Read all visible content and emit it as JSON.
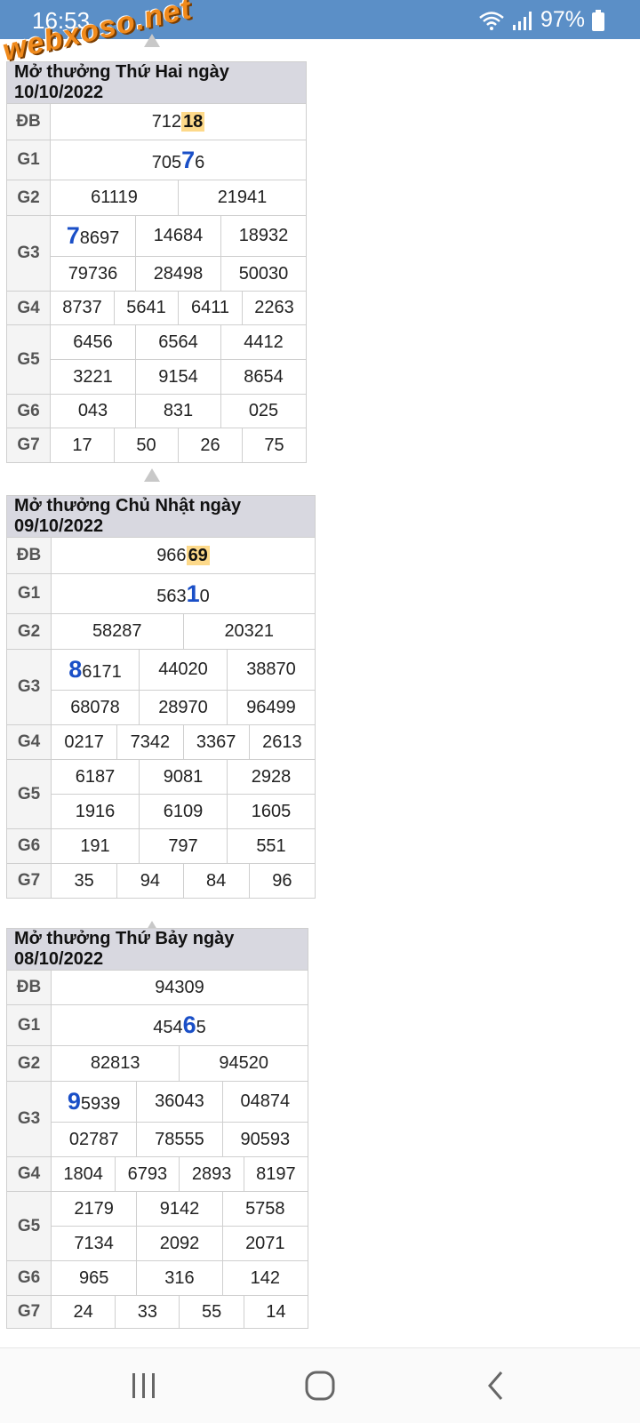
{
  "status_bar": {
    "time": "16:53",
    "battery": "97%"
  },
  "watermark": "webxoso.net",
  "draws": [
    {
      "title": "Mở thưởng Thứ Hai ngày 10/10/2022",
      "db": {
        "prefix": "712",
        "tail": "18"
      },
      "g1": {
        "before": "705",
        "big": "7",
        "after": "6"
      },
      "g2": [
        "61119",
        "21941"
      ],
      "g3": {
        "first_big": "7",
        "first_rest": "8697",
        "others": [
          "14684",
          "18932",
          "79736",
          "28498",
          "50030"
        ]
      },
      "g4": [
        "8737",
        "5641",
        "6411",
        "2263"
      ],
      "g5": [
        "6456",
        "6564",
        "4412",
        "3221",
        "9154",
        "8654"
      ],
      "g6": [
        "043",
        "831",
        "025"
      ],
      "g7": [
        "17",
        "50",
        "26",
        "75"
      ]
    },
    {
      "title": "Mở thưởng Chủ Nhật ngày 09/10/2022",
      "db": {
        "prefix": "966",
        "tail": "69"
      },
      "g1": {
        "before": "563",
        "big": "1",
        "after": "0"
      },
      "g2": [
        "58287",
        "20321"
      ],
      "g3": {
        "first_big": "8",
        "first_rest": "6171",
        "others": [
          "44020",
          "38870",
          "68078",
          "28970",
          "96499"
        ]
      },
      "g4": [
        "0217",
        "7342",
        "3367",
        "2613"
      ],
      "g5": [
        "6187",
        "9081",
        "2928",
        "1916",
        "6109",
        "1605"
      ],
      "g6": [
        "191",
        "797",
        "551"
      ],
      "g7": [
        "35",
        "94",
        "84",
        "96"
      ]
    },
    {
      "title": "Mở thưởng Thứ Bảy ngày 08/10/2022",
      "db": {
        "prefix": "94309",
        "tail": ""
      },
      "g1": {
        "before": "454",
        "big": "6",
        "after": "5"
      },
      "g2": [
        "82813",
        "94520"
      ],
      "g3": {
        "first_big": "9",
        "first_rest": "5939",
        "others": [
          "36043",
          "04874",
          "02787",
          "78555",
          "90593"
        ]
      },
      "g4": [
        "1804",
        "6793",
        "2893",
        "8197"
      ],
      "g5": [
        "2179",
        "9142",
        "5758",
        "7134",
        "2092",
        "2071"
      ],
      "g6": [
        "965",
        "316",
        "142"
      ],
      "g7": [
        "24",
        "33",
        "55",
        "14"
      ]
    }
  ],
  "labels": {
    "db": "ĐB",
    "g1": "G1",
    "g2": "G2",
    "g3": "G3",
    "g4": "G4",
    "g5": "G5",
    "g6": "G6",
    "g7": "G7"
  }
}
